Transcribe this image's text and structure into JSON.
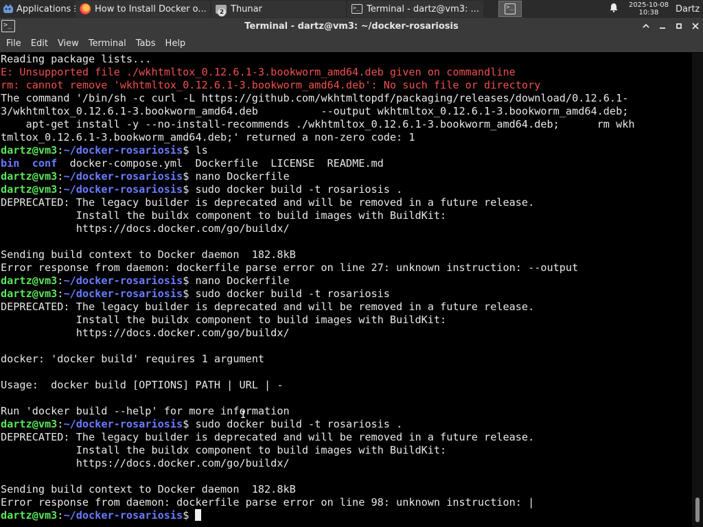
{
  "taskbar": {
    "applications_label": "Applications",
    "tasks": [
      {
        "label": "How to Install Docker o...",
        "icon": "firefox-icon"
      },
      {
        "label": "Thunar",
        "icon": "folder-icon",
        "badge": "2"
      },
      {
        "label": "Terminal - dartz@vm3: ...",
        "icon": "terminal-icon"
      }
    ],
    "date": "2025-10-08",
    "time": "10:38",
    "user": "Dartz"
  },
  "window": {
    "title": "Terminal - dartz@vm3: ~/docker-rosariosis"
  },
  "menu": [
    "File",
    "Edit",
    "View",
    "Terminal",
    "Tabs",
    "Help"
  ],
  "terminal": {
    "user": "dartz@vm3",
    "path": "~/docker-rosariosis",
    "lines": [
      [
        {
          "t": "Reading package lists..."
        }
      ],
      [
        {
          "t": "E: Unsupported file ./wkhtmltox_0.12.6.1-3.bookworm_amd64.deb given on commandline",
          "c": "red"
        }
      ],
      [
        {
          "t": "rm: cannot remove 'wkhtmltox_0.12.6.1-3.bookworm_amd64.deb': No such file or directory",
          "c": "red"
        }
      ],
      [
        {
          "t": "The command '/bin/sh -c curl -L https://github.com/wkhtmltopdf/packaging/releases/download/0.12.6.1-"
        }
      ],
      [
        {
          "t": "3/wkhtmltox_0.12.6.1-3.bookworm_amd64.deb          --output wkhtmltox_0.12.6.1-3.bookworm_amd64.deb;"
        }
      ],
      [
        {
          "t": "    apt-get install -y --no-install-recommends ./wkhtmltox_0.12.6.1-3.bookworm_amd64.deb;      rm wkh"
        }
      ],
      [
        {
          "t": "tmltox_0.12.6.1-3.bookworm_amd64.deb;' returned a non-zero code: 1"
        }
      ],
      [
        {
          "t": "dartz@vm3",
          "c": "user"
        },
        {
          "t": ":"
        },
        {
          "t": "~/docker-rosariosis",
          "c": "path"
        },
        {
          "t": "$ ls"
        }
      ],
      [
        {
          "t": "bin",
          "c": "dir"
        },
        {
          "t": "  "
        },
        {
          "t": "conf",
          "c": "dir"
        },
        {
          "t": "  docker-compose.yml  Dockerfile  LICENSE  README.md"
        }
      ],
      [
        {
          "t": "dartz@vm3",
          "c": "user"
        },
        {
          "t": ":"
        },
        {
          "t": "~/docker-rosariosis",
          "c": "path"
        },
        {
          "t": "$ nano Dockerfile"
        }
      ],
      [
        {
          "t": "dartz@vm3",
          "c": "user"
        },
        {
          "t": ":"
        },
        {
          "t": "~/docker-rosariosis",
          "c": "path"
        },
        {
          "t": "$ sudo docker build -t rosariosis ."
        }
      ],
      [
        {
          "t": "DEPRECATED: The legacy builder is deprecated and will be removed in a future release."
        }
      ],
      [
        {
          "t": "            Install the buildx component to build images with BuildKit:"
        }
      ],
      [
        {
          "t": "            https://docs.docker.com/go/buildx/"
        }
      ],
      [
        {
          "t": ""
        }
      ],
      [
        {
          "t": "Sending build context to Docker daemon  182.8kB"
        }
      ],
      [
        {
          "t": "Error response from daemon: dockerfile parse error on line 27: unknown instruction: --output"
        }
      ],
      [
        {
          "t": "dartz@vm3",
          "c": "user"
        },
        {
          "t": ":"
        },
        {
          "t": "~/docker-rosariosis",
          "c": "path"
        },
        {
          "t": "$ nano Dockerfile"
        }
      ],
      [
        {
          "t": "dartz@vm3",
          "c": "user"
        },
        {
          "t": ":"
        },
        {
          "t": "~/docker-rosariosis",
          "c": "path"
        },
        {
          "t": "$ sudo docker build -t rosariosis"
        }
      ],
      [
        {
          "t": "DEPRECATED: The legacy builder is deprecated and will be removed in a future release."
        }
      ],
      [
        {
          "t": "            Install the buildx component to build images with BuildKit:"
        }
      ],
      [
        {
          "t": "            https://docs.docker.com/go/buildx/"
        }
      ],
      [
        {
          "t": ""
        }
      ],
      [
        {
          "t": "docker: 'docker build' requires 1 argument"
        }
      ],
      [
        {
          "t": ""
        }
      ],
      [
        {
          "t": "Usage:  docker build [OPTIONS] PATH | URL | -"
        }
      ],
      [
        {
          "t": ""
        }
      ],
      [
        {
          "t": "Run 'docker build --help' for more information"
        }
      ],
      [
        {
          "t": "dartz@vm3",
          "c": "user"
        },
        {
          "t": ":"
        },
        {
          "t": "~/docker-rosariosis",
          "c": "path"
        },
        {
          "t": "$ sudo docker build -t rosariosis ."
        }
      ],
      [
        {
          "t": "DEPRECATED: The legacy builder is deprecated and will be removed in a future release."
        }
      ],
      [
        {
          "t": "            Install the buildx component to build images with BuildKit:"
        }
      ],
      [
        {
          "t": "            https://docs.docker.com/go/buildx/"
        }
      ],
      [
        {
          "t": ""
        }
      ],
      [
        {
          "t": "Sending build context to Docker daemon  182.8kB"
        }
      ],
      [
        {
          "t": "Error response from daemon: dockerfile parse error on line 98: unknown instruction: |"
        }
      ],
      [
        {
          "t": "dartz@vm3",
          "c": "user"
        },
        {
          "t": ":"
        },
        {
          "t": "~/docker-rosariosis",
          "c": "path"
        },
        {
          "t": "$ "
        },
        {
          "cursor": true
        }
      ]
    ]
  },
  "colors": {
    "taskbar_bg": "#2b2b2b",
    "titlebar_bg": "#3a3a3a",
    "terminal_bg": "#000000",
    "error_red": "#f05050",
    "prompt_user_green": "#5ce65c",
    "prompt_path_blue": "#6b7cff"
  }
}
